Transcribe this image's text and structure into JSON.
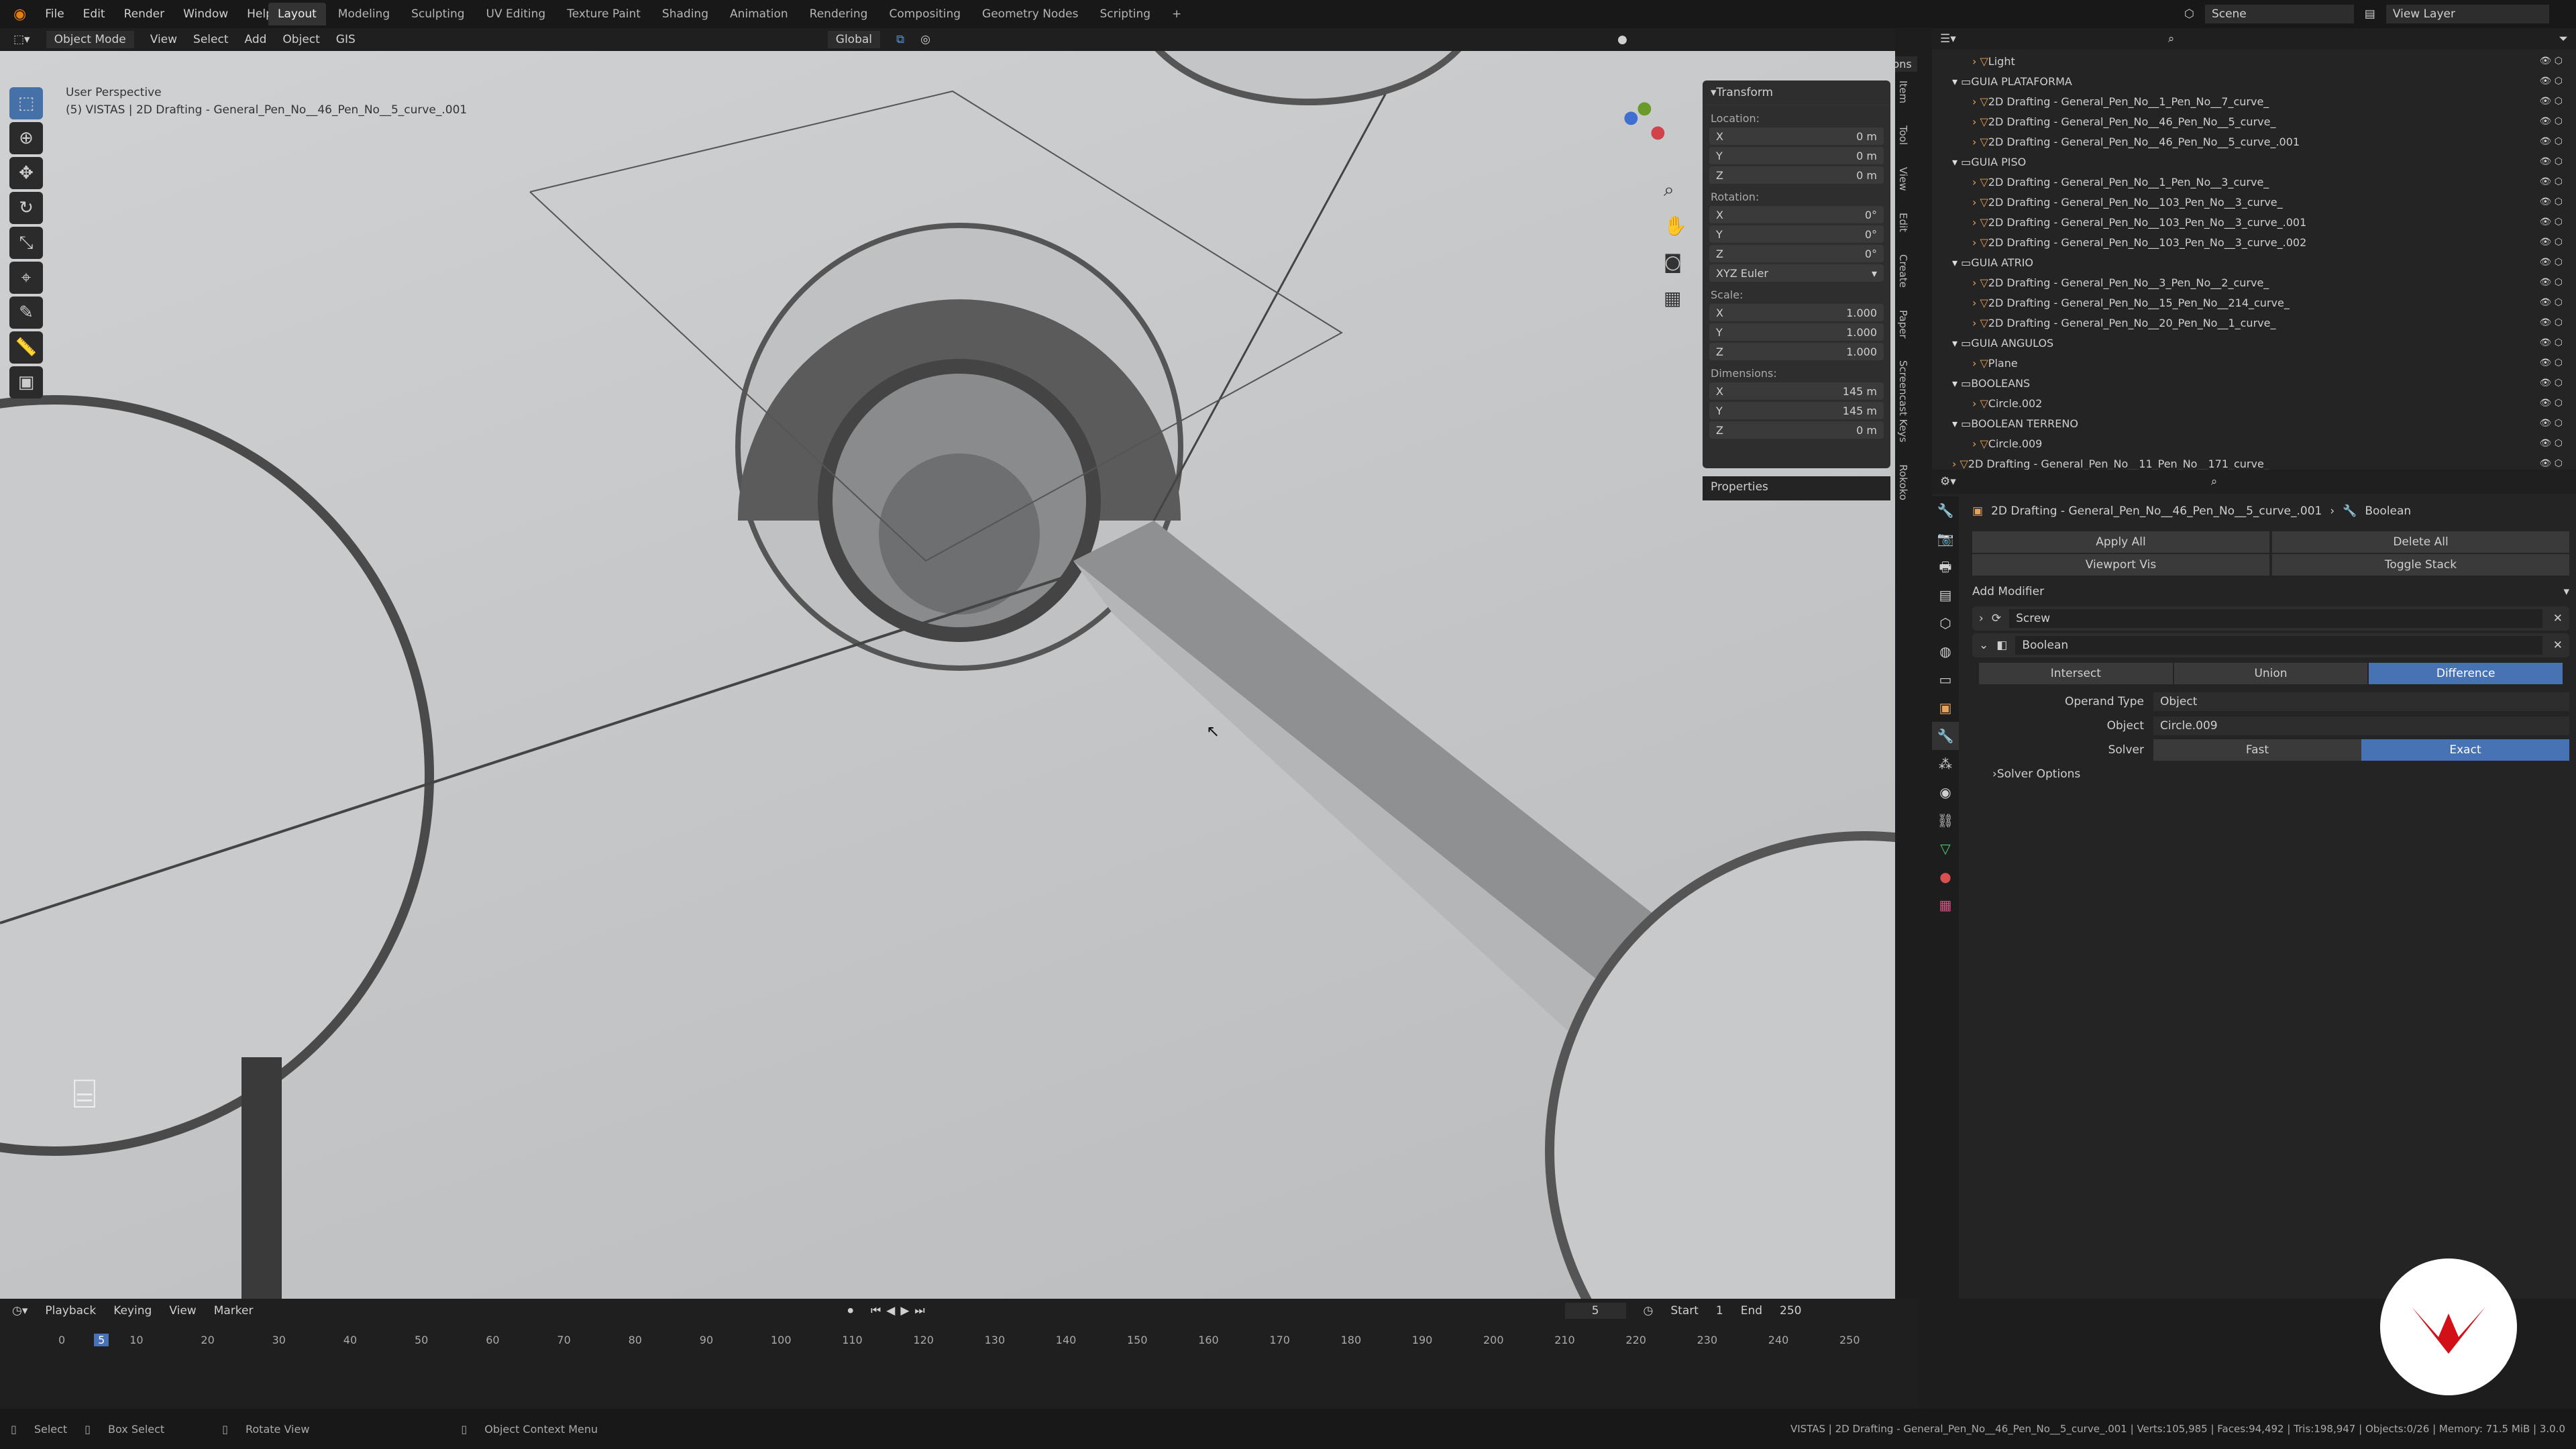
{
  "menu": [
    "File",
    "Edit",
    "Render",
    "Window",
    "Help"
  ],
  "workspaces": [
    "Layout",
    "Modeling",
    "Sculpting",
    "UV Editing",
    "Texture Paint",
    "Shading",
    "Animation",
    "Rendering",
    "Compositing",
    "Geometry Nodes",
    "Scripting"
  ],
  "scene": "Scene",
  "view_layer": "View Layer",
  "vp_header": {
    "mode": "Object Mode",
    "items": [
      "View",
      "Select",
      "Add",
      "Object",
      "GIS"
    ],
    "orientation": "Global",
    "options": "Options"
  },
  "viewport": {
    "title": "User Perspective",
    "subtitle": "(5) VISTAS | 2D Drafting - General_Pen_No__46_Pen_No__5_curve_.001"
  },
  "transform": {
    "title": "Transform",
    "location_label": "Location:",
    "rotation_label": "Rotation:",
    "scale_label": "Scale:",
    "dimensions_label": "Dimensions:",
    "loc": [
      "0 m",
      "0 m",
      "0 m"
    ],
    "rot": [
      "0°",
      "0°",
      "0°"
    ],
    "euler": "XYZ Euler",
    "scale": [
      "1.000",
      "1.000",
      "1.000"
    ],
    "dims": [
      "145 m",
      "145 m",
      "0 m"
    ],
    "properties": "Properties"
  },
  "side_tabs": [
    "Item",
    "Tool",
    "View",
    "Edit",
    "Create",
    "Paper",
    "Screencast Keys",
    "Rokoko"
  ],
  "outliner": [
    {
      "label": "Light",
      "indent": 2
    },
    {
      "label": "GUIA PLATAFORMA",
      "indent": 1
    },
    {
      "label": "2D Drafting - General_Pen_No__1_Pen_No__7_curve_",
      "indent": 2
    },
    {
      "label": "2D Drafting - General_Pen_No__46_Pen_No__5_curve_",
      "indent": 2
    },
    {
      "label": "2D Drafting - General_Pen_No__46_Pen_No__5_curve_.001",
      "indent": 2
    },
    {
      "label": "GUIA PISO",
      "indent": 1
    },
    {
      "label": "2D Drafting - General_Pen_No__1_Pen_No__3_curve_",
      "indent": 2
    },
    {
      "label": "2D Drafting - General_Pen_No__103_Pen_No__3_curve_",
      "indent": 2
    },
    {
      "label": "2D Drafting - General_Pen_No__103_Pen_No__3_curve_.001",
      "indent": 2
    },
    {
      "label": "2D Drafting - General_Pen_No__103_Pen_No__3_curve_.002",
      "indent": 2
    },
    {
      "label": "GUIA ATRIO",
      "indent": 1
    },
    {
      "label": "2D Drafting - General_Pen_No__3_Pen_No__2_curve_",
      "indent": 2
    },
    {
      "label": "2D Drafting - General_Pen_No__15_Pen_No__214_curve_",
      "indent": 2
    },
    {
      "label": "2D Drafting - General_Pen_No__20_Pen_No__1_curve_",
      "indent": 2
    },
    {
      "label": "GUIA ANGULOS",
      "indent": 1
    },
    {
      "label": "Plane",
      "indent": 2
    },
    {
      "label": "BOOLEANS",
      "indent": 1
    },
    {
      "label": "Circle.002",
      "indent": 2
    },
    {
      "label": "BOOLEAN TERRENO",
      "indent": 1
    },
    {
      "label": "Circle.009",
      "indent": 2
    },
    {
      "label": "2D Drafting - General_Pen_No__11_Pen_No__171_curve_",
      "indent": 1
    }
  ],
  "props": {
    "object": "2D Drafting - General_Pen_No__46_Pen_No__5_curve_.001",
    "modifier": "Boolean",
    "apply_all": "Apply All",
    "delete_all": "Delete All",
    "viewport_vis": "Viewport Vis",
    "toggle_stack": "Toggle Stack",
    "add_modifier": "Add Modifier",
    "mod1": "Screw",
    "mod2": "Boolean",
    "ops": [
      "Intersect",
      "Union",
      "Difference"
    ],
    "operand_label": "Operand Type",
    "operand": "Object",
    "object_label": "Object",
    "object_val": "Circle.009",
    "solver_label": "Solver",
    "solvers": [
      "Fast",
      "Exact"
    ],
    "solver_options": "Solver Options"
  },
  "timeline": {
    "items": [
      "Playback",
      "Keying",
      "View",
      "Marker"
    ],
    "frame": "5",
    "start_label": "Start",
    "start": "1",
    "end_label": "End",
    "end": "250",
    "ticks": [
      "0",
      "5",
      "10",
      "20",
      "30",
      "40",
      "50",
      "60",
      "70",
      "80",
      "90",
      "100",
      "110",
      "120",
      "130",
      "140",
      "150",
      "160",
      "170",
      "180",
      "190",
      "200",
      "210",
      "220",
      "230",
      "240",
      "250"
    ]
  },
  "status": {
    "select": "Select",
    "box": "Box Select",
    "rotate": "Rotate View",
    "context": "Object Context Menu",
    "info": "VISTAS | 2D Drafting - General_Pen_No__46_Pen_No__5_curve_.001 | Verts:105,985 | Faces:94,492 | Tris:198,947 | Objects:0/26 | Memory: 71.5 MiB | 3.0.0"
  }
}
